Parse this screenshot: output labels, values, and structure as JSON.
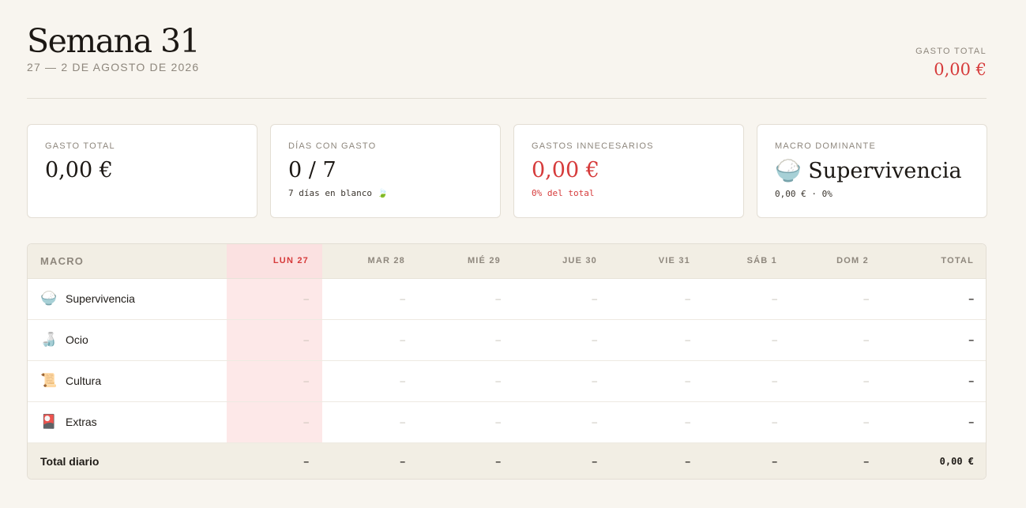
{
  "header": {
    "title": "Semana 31",
    "subtitle": "27 — 2 DE AGOSTO DE 2026",
    "total_label": "GASTO TOTAL",
    "total_value": "0,00 €"
  },
  "cards": [
    {
      "label": "GASTO TOTAL",
      "value": "0,00 €",
      "sub": ""
    },
    {
      "label": "DÍAS CON GASTO",
      "value": "0 / 7",
      "sub": "7 días en blanco 🍃"
    },
    {
      "label": "GASTOS INNECESARIOS",
      "value": "0,00 €",
      "sub": "0% del total"
    },
    {
      "label": "MACRO DOMINANTE",
      "value": "🍚 Supervivencia",
      "sub": "0,00 € · 0%"
    }
  ],
  "table": {
    "columns": [
      "MACRO",
      "LUN 27",
      "MAR 28",
      "MIÉ 29",
      "JUE 30",
      "VIE 31",
      "SÁB 1",
      "DOM 2",
      "TOTAL"
    ],
    "rows": [
      {
        "icon": "🍚",
        "name": "Supervivencia",
        "cells": [
          "–",
          "–",
          "–",
          "–",
          "–",
          "–",
          "–"
        ],
        "total": "–"
      },
      {
        "icon": "🍶",
        "name": "Ocio",
        "cells": [
          "–",
          "–",
          "–",
          "–",
          "–",
          "–",
          "–"
        ],
        "total": "–"
      },
      {
        "icon": "📜",
        "name": "Cultura",
        "cells": [
          "–",
          "–",
          "–",
          "–",
          "–",
          "–",
          "–"
        ],
        "total": "–"
      },
      {
        "icon": "🎴",
        "name": "Extras",
        "cells": [
          "–",
          "–",
          "–",
          "–",
          "–",
          "–",
          "–"
        ],
        "total": "–"
      }
    ],
    "footer": {
      "label": "Total diario",
      "cells": [
        "–",
        "–",
        "–",
        "–",
        "–",
        "–",
        "–"
      ],
      "total": "0,00 €"
    }
  }
}
